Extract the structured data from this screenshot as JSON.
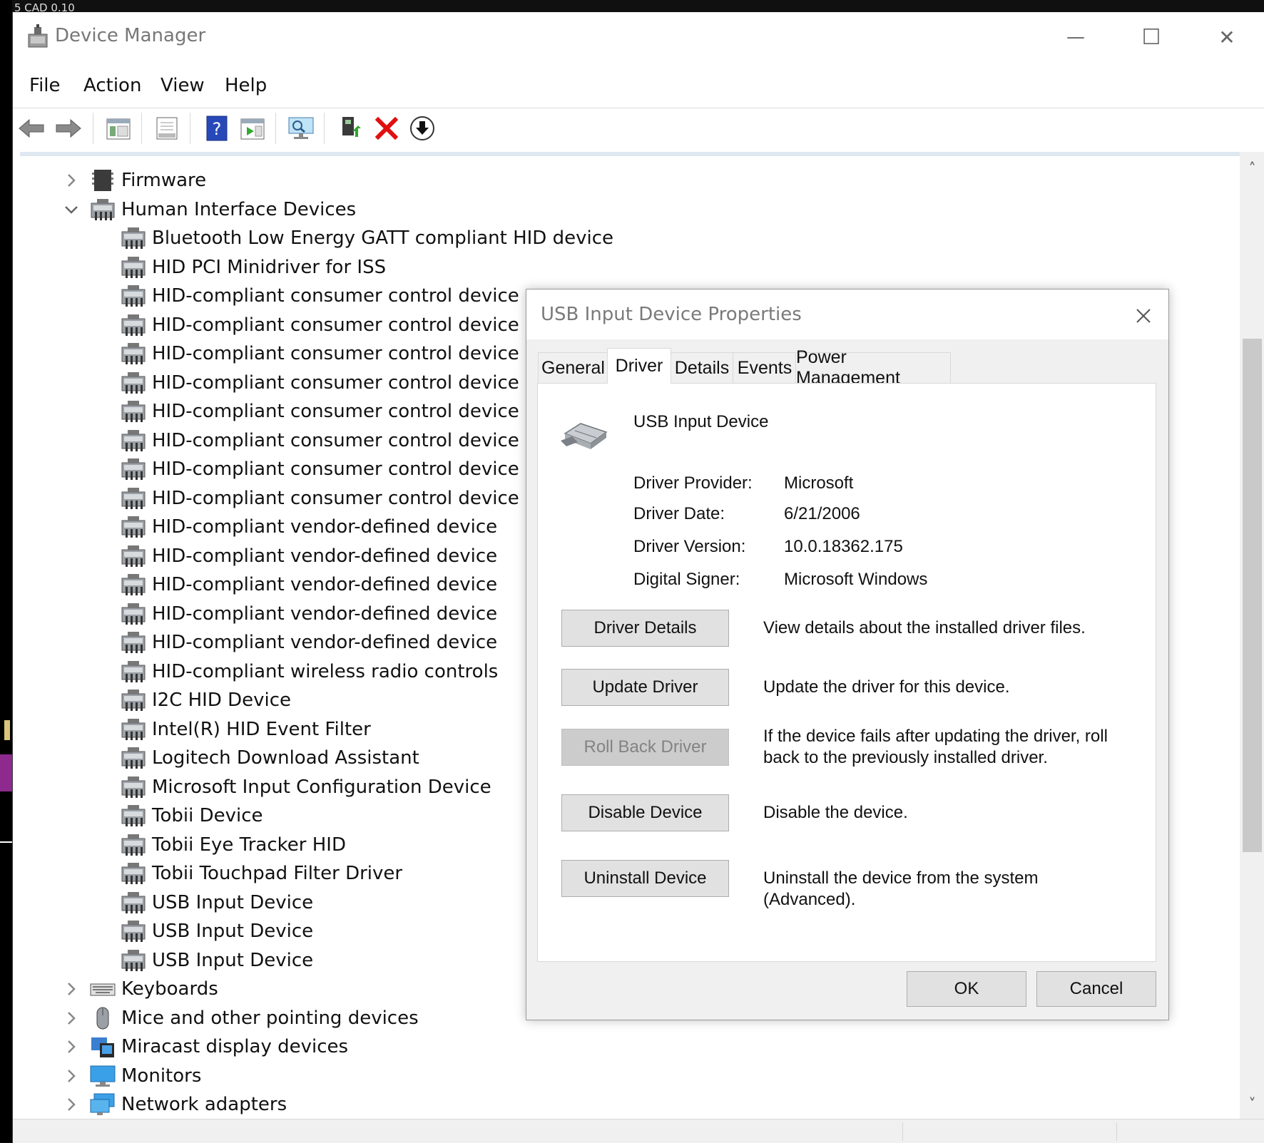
{
  "background": {
    "top_text": "5     CAD 0.10"
  },
  "window": {
    "title": "Device Manager",
    "controls": {
      "minimize": "—",
      "maximize": "☐",
      "close": "✕"
    }
  },
  "menu": [
    "File",
    "Action",
    "View",
    "Help"
  ],
  "toolbar": [
    "back-icon",
    "forward-icon",
    "properties-pane-icon",
    "device-properties-icon",
    "help-icon",
    "show-hidden-icon",
    "scan-hardware-icon",
    "update-driver-icon",
    "uninstall-icon",
    "download-icon"
  ],
  "tree": {
    "categories_top": [
      {
        "label": "Firmware",
        "expanded": false
      },
      {
        "label": "Human Interface Devices",
        "expanded": true
      }
    ],
    "children": [
      "Bluetooth Low Energy GATT compliant HID device",
      "HID PCI Minidriver for ISS",
      "HID-compliant consumer control device",
      "HID-compliant consumer control device",
      "HID-compliant consumer control device",
      "HID-compliant consumer control device",
      "HID-compliant consumer control device",
      "HID-compliant consumer control device",
      "HID-compliant consumer control device",
      "HID-compliant consumer control device",
      "HID-compliant vendor-defined device",
      "HID-compliant vendor-defined device",
      "HID-compliant vendor-defined device",
      "HID-compliant vendor-defined device",
      "HID-compliant vendor-defined device",
      "HID-compliant wireless radio controls",
      "I2C HID Device",
      "Intel(R) HID Event Filter",
      "Logitech Download Assistant",
      "Microsoft Input Configuration Device",
      "Tobii Device",
      "Tobii Eye Tracker HID",
      "Tobii Touchpad Filter Driver",
      "USB Input Device",
      "USB Input Device",
      "USB Input Device"
    ],
    "categories_bottom": [
      {
        "label": "Keyboards",
        "icon": "keyboard-icon"
      },
      {
        "label": "Mice and other pointing devices",
        "icon": "mouse-icon"
      },
      {
        "label": "Miracast display devices",
        "icon": "miracast-icon"
      },
      {
        "label": "Monitors",
        "icon": "monitor-icon"
      },
      {
        "label": "Network adapters",
        "icon": "network-adapter-icon"
      }
    ]
  },
  "dialog": {
    "title": "USB Input Device Properties",
    "tabs": [
      "General",
      "Driver",
      "Details",
      "Events",
      "Power Management"
    ],
    "active_tab": "Driver",
    "device_name": "USB Input Device",
    "properties": [
      {
        "label": "Driver Provider:",
        "value": "Microsoft"
      },
      {
        "label": "Driver Date:",
        "value": "6/21/2006"
      },
      {
        "label": "Driver Version:",
        "value": "10.0.18362.175"
      },
      {
        "label": "Digital Signer:",
        "value": "Microsoft Windows"
      }
    ],
    "actions": [
      {
        "label": "Driver Details",
        "desc": "View details about the installed driver files.",
        "enabled": true
      },
      {
        "label": "Update Driver",
        "desc": "Update the driver for this device.",
        "enabled": true
      },
      {
        "label": "Roll Back Driver",
        "desc": "If the device fails after updating the driver, roll back to the previously installed driver.",
        "enabled": false
      },
      {
        "label": "Disable Device",
        "desc": "Disable the device.",
        "enabled": true
      },
      {
        "label": "Uninstall Device",
        "desc": "Uninstall the device from the system (Advanced).",
        "enabled": true
      }
    ],
    "ok_label": "OK",
    "cancel_label": "Cancel"
  }
}
